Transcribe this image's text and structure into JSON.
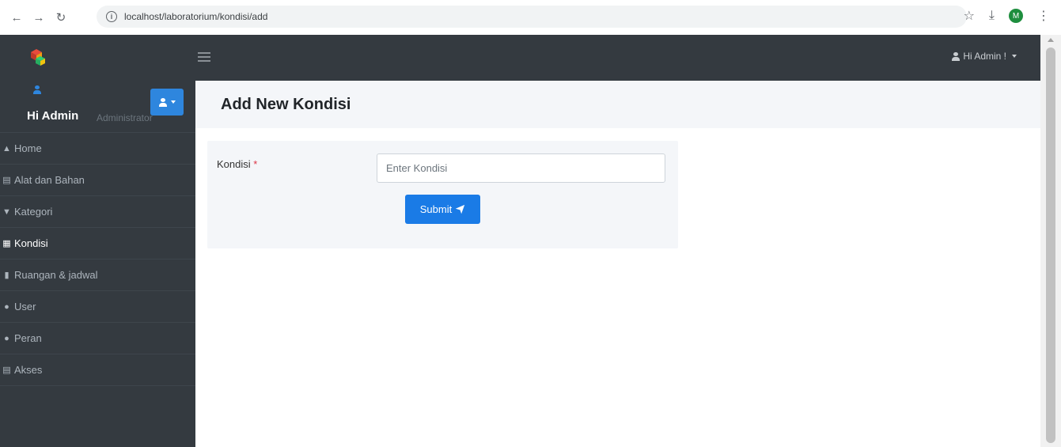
{
  "browser": {
    "url": "localhost/laboratorium/kondisi/add",
    "profile_initial": "M"
  },
  "topbar": {
    "user_menu_label": "Hi Admin !"
  },
  "sidebar": {
    "profile_name": "Hi Admin",
    "profile_role": "Administrator",
    "items": [
      {
        "label": "Home",
        "icon": "home-icon"
      },
      {
        "label": "Alat dan Bahan",
        "icon": "database-icon"
      },
      {
        "label": "Kategori",
        "icon": "filter-icon"
      },
      {
        "label": "Kondisi",
        "icon": "calculator-icon"
      },
      {
        "label": "Ruangan & jadwal",
        "icon": "file-icon"
      },
      {
        "label": "User",
        "icon": "user-icon"
      },
      {
        "label": "Peran",
        "icon": "users-icon"
      },
      {
        "label": "Akses",
        "icon": "database-icon"
      }
    ],
    "active_item": "Kondisi"
  },
  "main": {
    "page_title": "Add New Kondisi",
    "form": {
      "kondisi_label": "Kondisi",
      "required_marker": "*",
      "kondisi_placeholder": "Enter Kondisi",
      "kondisi_value": "",
      "submit_label": "Submit"
    }
  },
  "colors": {
    "topbar": "#343a40",
    "sidebar": "#343a40",
    "primary": "#1a7be6",
    "required": "#dc3545",
    "content_header": "#f4f6f9"
  }
}
